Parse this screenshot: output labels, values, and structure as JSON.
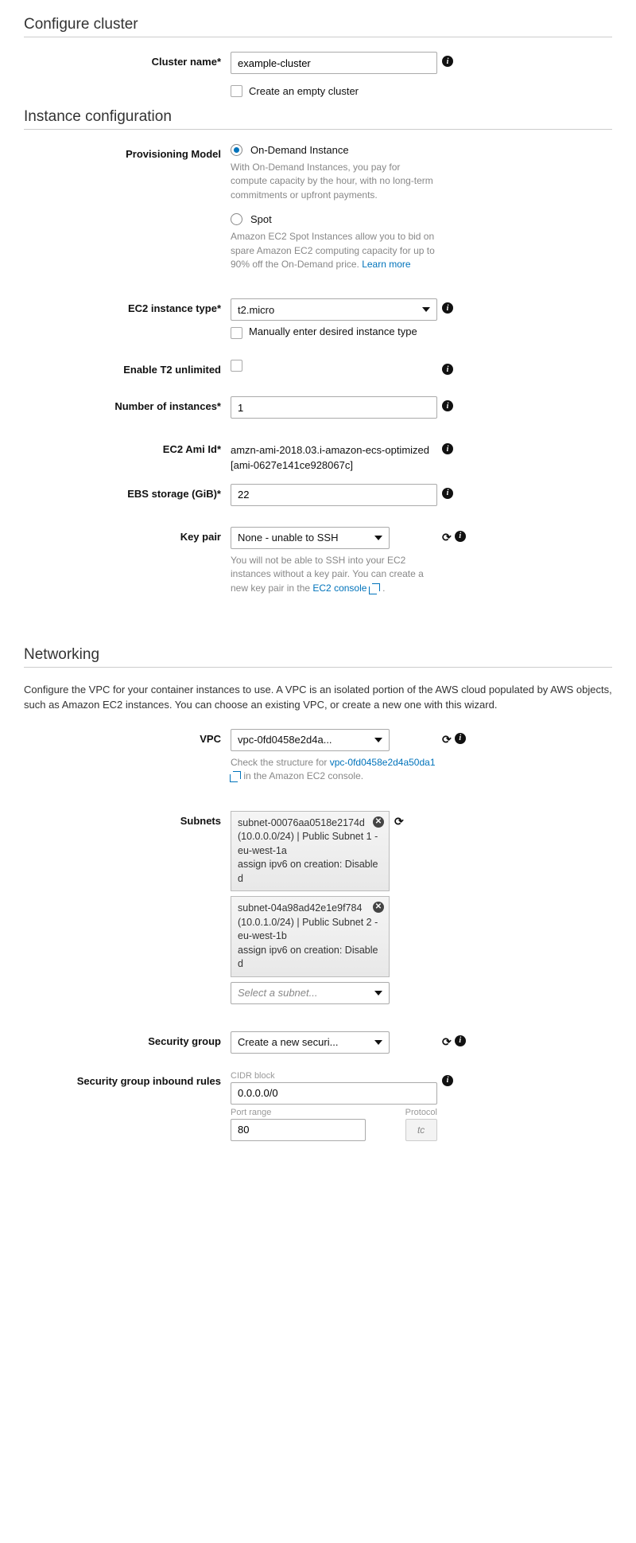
{
  "configureCluster": {
    "title": "Configure cluster",
    "clusterName": {
      "label": "Cluster name*",
      "value": "example-cluster"
    },
    "emptyCluster": {
      "label": "Create an empty cluster"
    }
  },
  "instanceConfig": {
    "title": "Instance configuration",
    "provisioningModel": {
      "label": "Provisioning Model",
      "onDemand": {
        "label": "On-Demand Instance",
        "help": "With On-Demand Instances, you pay for compute capacity by the hour, with no long-term commitments or upfront payments."
      },
      "spot": {
        "label": "Spot",
        "help": "Amazon EC2 Spot Instances allow you to bid on spare Amazon EC2 computing capacity for up to 90% off the On-Demand price. ",
        "learnMore": "Learn more"
      }
    },
    "ec2Type": {
      "label": "EC2 instance type*",
      "value": "t2.micro",
      "manualLabel": "Manually enter desired instance type"
    },
    "t2Unlimited": {
      "label": "Enable T2 unlimited"
    },
    "numInstances": {
      "label": "Number of instances*",
      "value": "1"
    },
    "amiId": {
      "label": "EC2 Ami Id*",
      "value": "amzn-ami-2018.03.i-amazon-ecs-optimized [ami-0627e141ce928067c]"
    },
    "ebs": {
      "label": "EBS storage (GiB)*",
      "value": "22"
    },
    "keyPair": {
      "label": "Key pair",
      "value": "None - unable to SSH",
      "help": "You will not be able to SSH into your EC2 instances without a key pair. You can create a new key pair in the ",
      "link": "EC2 console"
    }
  },
  "networking": {
    "title": "Networking",
    "description": "Configure the VPC for your container instances to use. A VPC is an isolated portion of the AWS cloud populated by AWS objects, such as Amazon EC2 instances. You can choose an existing VPC, or create a new one with this wizard.",
    "vpc": {
      "label": "VPC",
      "value": "vpc-0fd0458e2d4a...",
      "helpPrefix": "Check the structure for ",
      "vpcLink": "vpc-0fd0458e2d4a50da1",
      "helpSuffix": " in the Amazon EC2 console."
    },
    "subnets": {
      "label": "Subnets",
      "items": [
        "subnet-00076aa0518e2174d\n(10.0.0.0/24) | Public Subnet 1 - eu-west-1a\nassign ipv6 on creation: Disabled",
        "subnet-04a98ad42e1e9f784\n(10.0.1.0/24) | Public Subnet 2 - eu-west-1b\nassign ipv6 on creation: Disabled"
      ],
      "placeholder": "Select a subnet..."
    },
    "securityGroup": {
      "label": "Security group",
      "value": "Create a new securi..."
    },
    "inbound": {
      "label": "Security group inbound rules",
      "cidrLabel": "CIDR block",
      "cidrValue": "0.0.0.0/0",
      "portLabel": "Port range",
      "portValue": "80",
      "protocolLabel": "Protocol",
      "protocolValue": "tc"
    }
  }
}
